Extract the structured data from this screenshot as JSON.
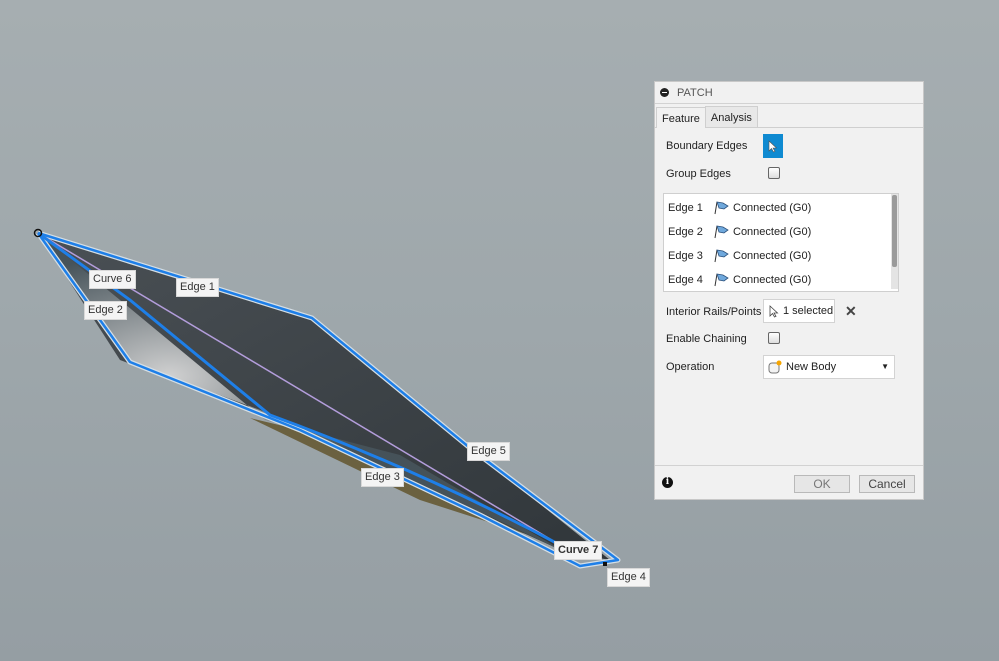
{
  "viewport": {
    "labels": [
      {
        "id": "curve-6",
        "text": "Curve 6"
      },
      {
        "id": "edge-1",
        "text": "Edge 1"
      },
      {
        "id": "edge-2",
        "text": "Edge 2"
      },
      {
        "id": "edge-5",
        "text": "Edge 5"
      },
      {
        "id": "edge-3",
        "text": "Edge 3"
      },
      {
        "id": "curve-7",
        "text": "Curve 7"
      },
      {
        "id": "edge-4",
        "text": "Edge 4"
      }
    ],
    "colors": {
      "selection": "#1e7fe8",
      "rail": "#b39ddb",
      "surface_dark": "#3a3f43"
    }
  },
  "panel": {
    "title": "PATCH",
    "tabs": [
      {
        "label": "Feature",
        "active": true
      },
      {
        "label": "Analysis",
        "active": false
      }
    ],
    "boundary_edges_label": "Boundary Edges",
    "group_edges_label": "Group Edges",
    "group_edges_checked": false,
    "edges": [
      {
        "name": "Edge 1",
        "status": "Connected (G0)"
      },
      {
        "name": "Edge 2",
        "status": "Connected (G0)"
      },
      {
        "name": "Edge 3",
        "status": "Connected (G0)"
      },
      {
        "name": "Edge 4",
        "status": "Connected (G0)"
      }
    ],
    "interior_rails_label": "Interior Rails/Points",
    "interior_rails_value": "1 selected",
    "enable_chaining_label": "Enable Chaining",
    "enable_chaining_checked": false,
    "operation_label": "Operation",
    "operation_value": "New Body",
    "ok_label": "OK",
    "cancel_label": "Cancel",
    "accent": "#0f8ad1"
  }
}
